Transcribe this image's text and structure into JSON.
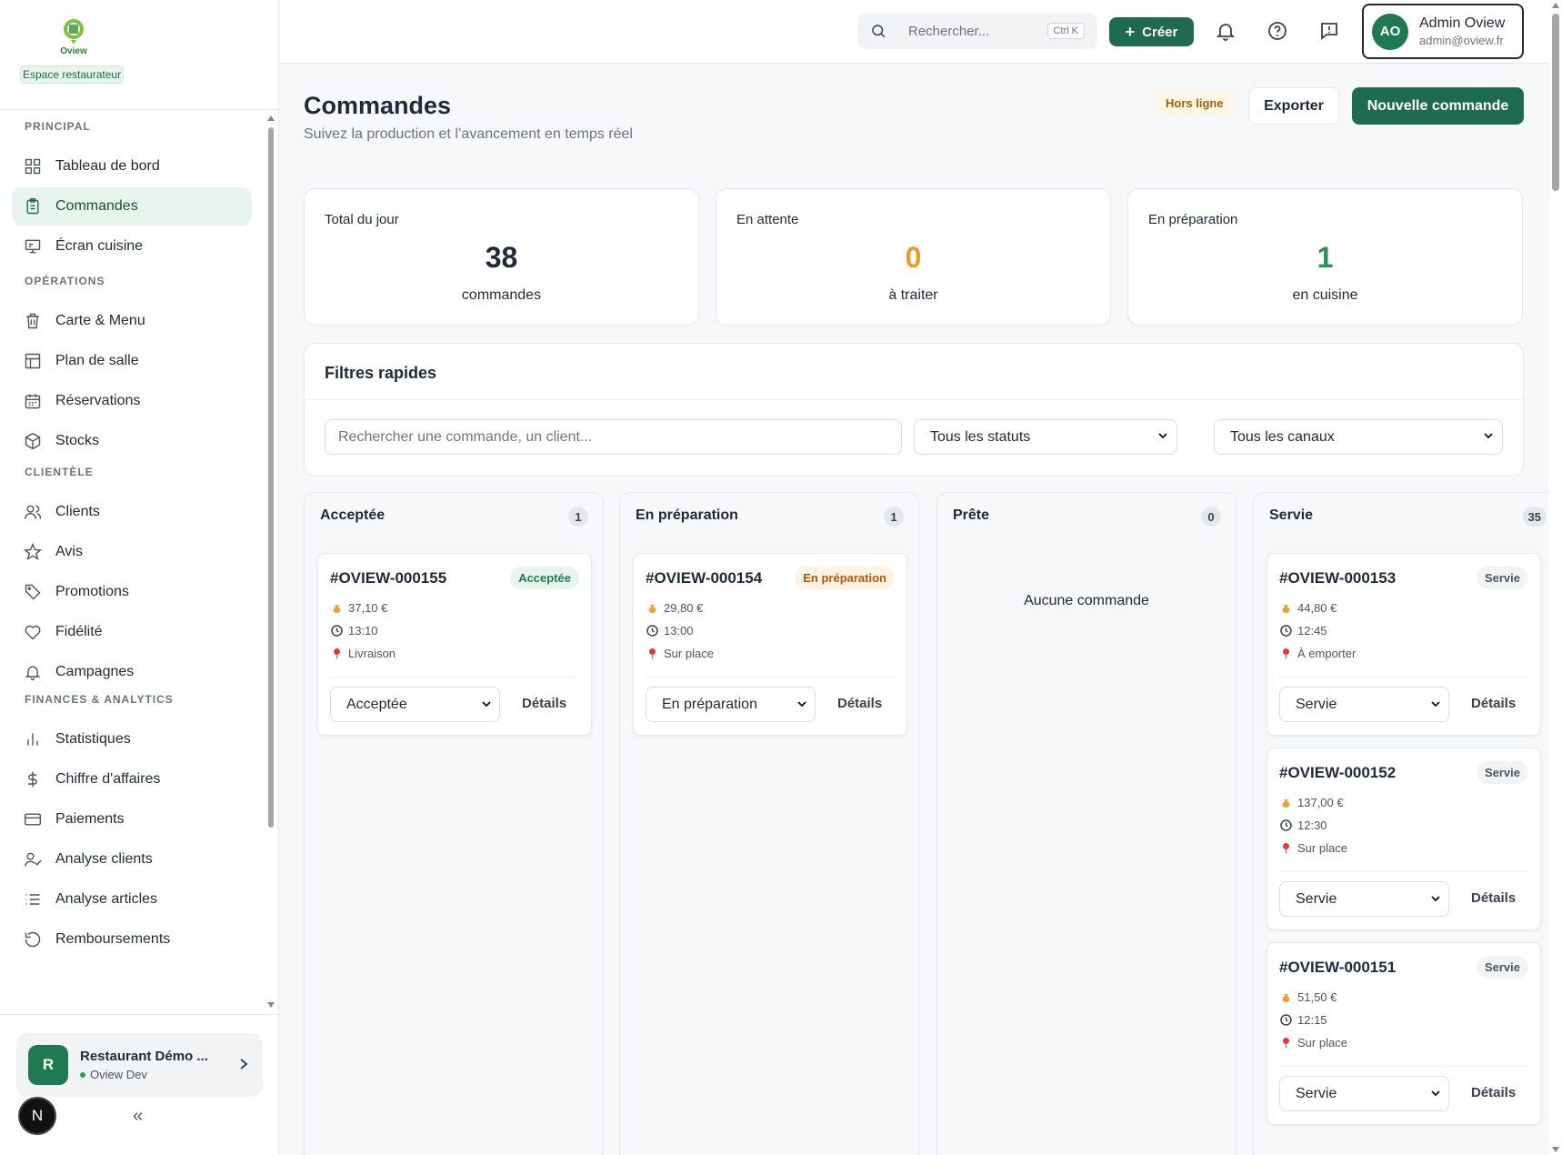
{
  "sidebar": {
    "brand": "Oview",
    "space_label": "Espace restaurateur",
    "sections": [
      {
        "title": "PRINCIPAL",
        "items": [
          {
            "label": "Tableau de bord",
            "icon": "grid-icon"
          },
          {
            "label": "Commandes",
            "icon": "clipboard-icon",
            "active": true
          },
          {
            "label": "Écran cuisine",
            "icon": "monitor-icon"
          }
        ]
      },
      {
        "title": "OPÉRATIONS",
        "items": [
          {
            "label": "Carte & Menu",
            "icon": "trash-menu-icon"
          },
          {
            "label": "Plan de salle",
            "icon": "layout-icon"
          },
          {
            "label": "Réservations",
            "icon": "calendar-icon"
          },
          {
            "label": "Stocks",
            "icon": "box-icon"
          }
        ]
      },
      {
        "title": "CLIENTÈLE",
        "items": [
          {
            "label": "Clients",
            "icon": "users-icon"
          },
          {
            "label": "Avis",
            "icon": "star-icon"
          },
          {
            "label": "Promotions",
            "icon": "tag-icon"
          },
          {
            "label": "Fidélité",
            "icon": "heart-icon"
          },
          {
            "label": "Campagnes",
            "icon": "bell-icon"
          }
        ]
      },
      {
        "title": "FINANCES & ANALYTICS",
        "items": [
          {
            "label": "Statistiques",
            "icon": "bar-chart-icon"
          },
          {
            "label": "Chiffre d'affaires",
            "icon": "dollar-icon"
          },
          {
            "label": "Paiements",
            "icon": "credit-card-icon"
          },
          {
            "label": "Analyse clients",
            "icon": "user-check-icon"
          },
          {
            "label": "Analyse articles",
            "icon": "list-icon"
          },
          {
            "label": "Remboursements",
            "icon": "refund-icon"
          }
        ]
      }
    ],
    "restaurant": {
      "initial": "R",
      "name": "Restaurant Démo ...",
      "env": "Oview Dev"
    },
    "n_badge": "N",
    "collapse_label": "«"
  },
  "topbar": {
    "search_placeholder": "Rechercher...",
    "search_shortcut": "Ctrl K",
    "create_label": "Créer",
    "user": {
      "initials": "AO",
      "name": "Admin Oview",
      "email": "admin@oview.fr"
    }
  },
  "page": {
    "title": "Commandes",
    "subtitle": "Suivez la production et l’avancement en temps réel",
    "offline_label": "Hors ligne",
    "export_label": "Exporter",
    "new_label": "Nouvelle commande"
  },
  "stats": [
    {
      "label": "Total du jour",
      "value": "38",
      "caption": "commandes",
      "color": "#1f2937"
    },
    {
      "label": "En attente",
      "value": "0",
      "caption": "à traiter",
      "color": "#e49b2a"
    },
    {
      "label": "En préparation",
      "value": "1",
      "caption": "en cuisine",
      "color": "#2f8f5b"
    }
  ],
  "filters": {
    "title": "Filtres rapides",
    "search_placeholder": "Rechercher une commande, un client...",
    "status_select": "Tous les statuts",
    "channel_select": "Tous les canaux"
  },
  "columns": [
    {
      "title": "Acceptée",
      "count": "1",
      "empty_text": "",
      "orders": [
        {
          "id": "#OVIEW-000155",
          "status": "Acceptée",
          "amount": "37,10 €",
          "time": "13:10",
          "mode": "Livraison",
          "details": "Détails"
        }
      ]
    },
    {
      "title": "En préparation",
      "count": "1",
      "empty_text": "",
      "orders": [
        {
          "id": "#OVIEW-000154",
          "status": "En préparation",
          "amount": "29,80 €",
          "time": "13:00",
          "mode": "Sur place",
          "details": "Détails"
        }
      ]
    },
    {
      "title": "Prête",
      "count": "0",
      "empty_text": "Aucune commande",
      "orders": []
    },
    {
      "title": "Servie",
      "count": "35",
      "empty_text": "",
      "orders": [
        {
          "id": "#OVIEW-000153",
          "status": "Servie",
          "amount": "44,80 €",
          "time": "12:45",
          "mode": "À emporter",
          "details": "Détails"
        },
        {
          "id": "#OVIEW-000152",
          "status": "Servie",
          "amount": "137,00 €",
          "time": "12:30",
          "mode": "Sur place",
          "details": "Détails"
        },
        {
          "id": "#OVIEW-000151",
          "status": "Servie",
          "amount": "51,50 €",
          "time": "12:15",
          "mode": "Sur place",
          "details": "Détails"
        }
      ]
    }
  ],
  "colors": {
    "accent": "#1f6b4f",
    "accepted_bg": "#e8f5ee",
    "accepted_fg": "#1f7a52",
    "prep_bg": "#fdf2e3",
    "prep_fg": "#b45309",
    "served_bg": "#f1f3f5",
    "served_fg": "#4b5563"
  }
}
